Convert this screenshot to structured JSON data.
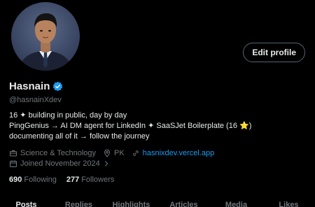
{
  "profile": {
    "display_name": "Hasnain",
    "handle": "@hasnainXdev",
    "edit_label": "Edit profile",
    "verified": true
  },
  "bio": {
    "line1": "16 ✦ building in public, day by day",
    "line2_prefix": "PingGenius → AI DM agent for LinkedIn ✦ SaaSJet Boilerplate (16 ",
    "line2_star": "⭐",
    "line2_suffix": ")",
    "line3": "documenting all of it → follow the journey"
  },
  "meta": {
    "category": "Science & Technology",
    "location": "PK",
    "website": "hasnixdev.vercel.app",
    "joined": "Joined November 2024"
  },
  "follow": {
    "following_count": "690",
    "following_label": "Following",
    "followers_count": "277",
    "followers_label": "Followers"
  },
  "tabs": [
    {
      "label": "Posts",
      "active": true
    },
    {
      "label": "Replies",
      "active": false
    },
    {
      "label": "Highlights",
      "active": false
    },
    {
      "label": "Articles",
      "active": false
    },
    {
      "label": "Media",
      "active": false
    },
    {
      "label": "Likes",
      "active": false
    }
  ],
  "colors": {
    "background": "#000000",
    "text_primary": "#e7e9ea",
    "text_secondary": "#71767b",
    "accent": "#1d9bf0"
  }
}
